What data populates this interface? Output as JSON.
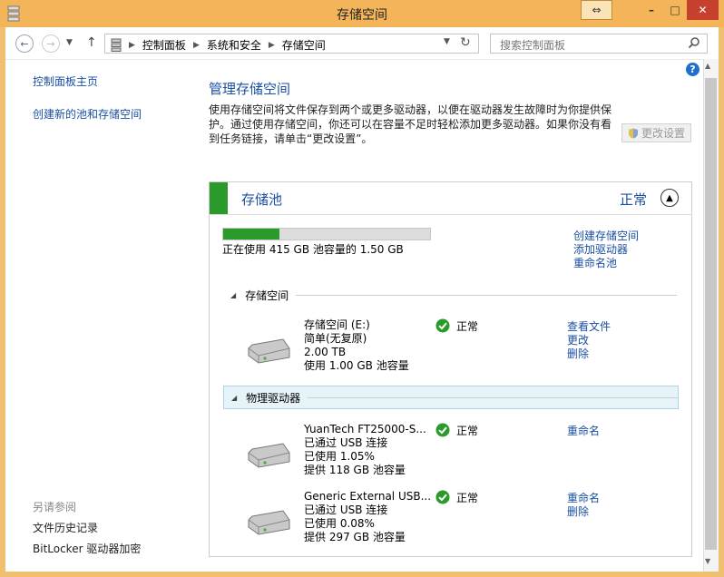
{
  "window": {
    "title": "存储空间",
    "buttons": {
      "restore": "⇔",
      "minimize": "–",
      "maximize": "□",
      "close": "✕"
    }
  },
  "addressbar": {
    "crumbs": [
      "控制面板",
      "系统和安全",
      "存储空间"
    ],
    "search_placeholder": "搜索控制面板"
  },
  "sidebar": {
    "home": "控制面板主页",
    "create": "创建新的池和存储空间",
    "see_also": "另请参阅",
    "file_history": "文件历史记录",
    "bitlocker": "BitLocker 驱动器加密"
  },
  "main": {
    "heading": "管理存储空间",
    "description": "使用存储空间将文件保存到两个或更多驱动器，以便在驱动器发生故障时为你提供保护。通过使用存储空间，你还可以在容量不足时轻松添加更多驱动器。如果你没有看到任务链接，请单击“更改设置”。",
    "change_settings": "更改设置",
    "pool": {
      "title": "存储池",
      "status": "正常",
      "usage_fraction": 0.27,
      "usage_text": "正在使用 415 GB 池容量的 1.50 GB",
      "links": {
        "create": "创建存储空间",
        "add": "添加驱动器",
        "rename": "重命名池"
      }
    },
    "spaces_section": "存储空间",
    "spaces": [
      {
        "lines": [
          "存储空间 (E:)",
          "简单(无复原)",
          "2.00 TB",
          "使用 1.00 GB 池容量"
        ],
        "status": "正常",
        "links": [
          "查看文件",
          "更改",
          "删除"
        ]
      }
    ],
    "physical_section": "物理驱动器",
    "drives": [
      {
        "lines": [
          "YuanTech FT25000-S...",
          "已通过 USB 连接",
          "已使用 1.05%",
          "提供 118 GB 池容量"
        ],
        "status": "正常",
        "links": [
          "重命名"
        ]
      },
      {
        "lines": [
          "Generic External USB...",
          "已通过 USB 连接",
          "已使用 0.08%",
          "提供 297 GB 池容量"
        ],
        "status": "正常",
        "links": [
          "重命名",
          "删除"
        ]
      }
    ]
  },
  "colors": {
    "accent": "#1a4fa3",
    "ok": "#2a9a2a",
    "titlebar": "#f4b55a"
  }
}
